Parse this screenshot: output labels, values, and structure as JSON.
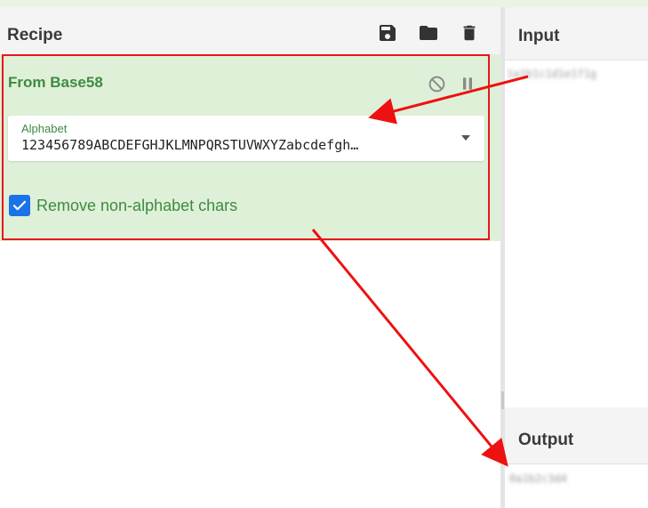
{
  "recipe": {
    "title": "Recipe",
    "icons": {
      "save": "save-icon",
      "load": "folder-icon",
      "clear": "trash-icon"
    }
  },
  "operation": {
    "title": "From Base58",
    "icons": {
      "disable": "disable-icon",
      "pause": "pause-icon"
    },
    "alphabet": {
      "label": "Alphabet",
      "value": "123456789ABCDEFGHJKLMNPQRSTUVWXYZabcdefgh…"
    },
    "checkbox": {
      "label": "Remove non-alphabet chars",
      "checked": true
    }
  },
  "input": {
    "title": "Input",
    "text": "1a1b1c1d1e1f1g"
  },
  "output": {
    "title": "Output",
    "text": "0a1b2c3d4"
  },
  "colors": {
    "accent_green": "#3d8b40",
    "card_background": "#dff0d8",
    "highlight_red": "#e8161c",
    "checkbox_blue": "#1a73e8"
  }
}
